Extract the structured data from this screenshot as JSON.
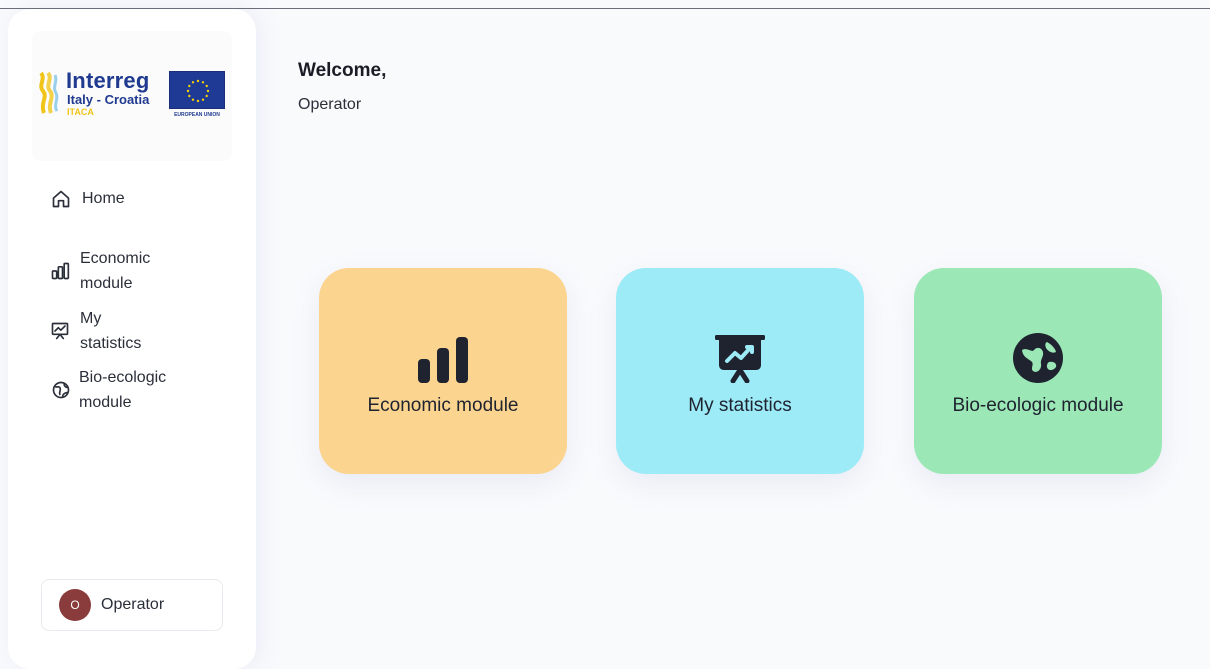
{
  "logo": {
    "brand": "Interreg",
    "region": "Italy - Croatia",
    "project": "ITACA",
    "eu_label": "EUROPEAN UNION"
  },
  "sidebar": {
    "items": [
      {
        "label": "Home",
        "icon": "home-icon"
      },
      {
        "label": "Economic module",
        "icon": "bar-chart-icon"
      },
      {
        "label": "My statistics",
        "icon": "presentation-chart-icon"
      },
      {
        "label": "Bio-ecologic module",
        "icon": "globe-icon"
      }
    ],
    "user": {
      "initial": "O",
      "name": "Operator"
    }
  },
  "main": {
    "welcome": "Welcome,",
    "user_name": "Operator",
    "cards": [
      {
        "label": "Economic module",
        "icon": "bar-chart-icon",
        "color": "#fbd48f"
      },
      {
        "label": "My statistics",
        "icon": "presentation-chart-icon",
        "color": "#9debf7"
      },
      {
        "label": "Bio-ecologic module",
        "icon": "globe-icon",
        "color": "#9be8b6"
      }
    ]
  },
  "colors": {
    "avatar": "#8a3b3b",
    "brand_blue": "#1f3a8f",
    "brand_yellow": "#f0c419"
  }
}
